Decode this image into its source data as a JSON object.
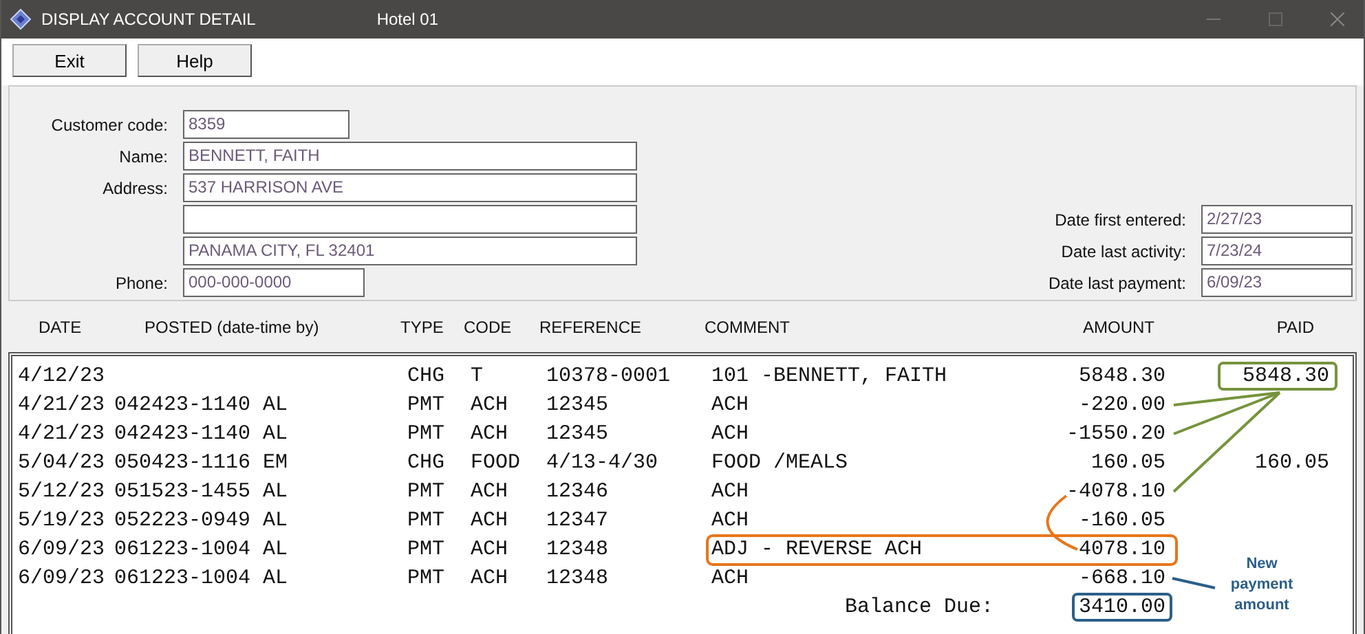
{
  "window": {
    "title": "DISPLAY ACCOUNT DETAIL",
    "subtitle": "Hotel 01"
  },
  "toolbar": {
    "buttons": [
      "Exit",
      "Help"
    ]
  },
  "customer": {
    "fields": [
      {
        "label": "Customer code:",
        "value": "8359",
        "kind": "short"
      },
      {
        "label": "Name:",
        "value": "BENNETT, FAITH",
        "kind": "long"
      },
      {
        "label": "Address:",
        "value": "537 HARRISON AVE",
        "kind": "long"
      },
      {
        "kind": "long"
      },
      {
        "value": "PANAMA CITY, FL 32401",
        "kind": "long"
      },
      {
        "label": "Phone:",
        "value": "000-000-0000",
        "kind": "medium"
      }
    ],
    "dates": [
      {
        "label": "Date first entered:",
        "value": "2/27/23"
      },
      {
        "label": "Date last activity:",
        "value": "7/23/24"
      },
      {
        "label": "Date last payment:",
        "value": "6/09/23"
      }
    ]
  },
  "ledger": {
    "columns": [
      "DATE",
      "POSTED (date-time by)",
      "TYPE",
      "CODE",
      "REFERENCE",
      "COMMENT",
      "AMOUNT",
      "PAID"
    ],
    "rows": [
      {
        "date": "4/12/23",
        "type": "CHG",
        "code": "T",
        "reference": "10378-0001",
        "comment": "101 -BENNETT, FAITH",
        "amount": "5848.30",
        "paid": "5848.30",
        "kind": "boxed-paid"
      },
      {
        "date": "4/21/23",
        "posted": "042423-1140 AL",
        "type": "PMT",
        "code": "ACH",
        "reference": "12345",
        "comment": "ACH",
        "amount": "-220.00",
        "kind": "linked"
      },
      {
        "date": "4/21/23",
        "posted": "042423-1140 AL",
        "type": "PMT",
        "code": "ACH",
        "reference": "12345",
        "comment": "ACH",
        "amount": "-1550.20",
        "kind": "linked"
      },
      {
        "date": "5/04/23",
        "posted": "050423-1116 EM",
        "type": "CHG",
        "code": "FOOD",
        "reference": "4/13-4/30",
        "comment": "FOOD /MEALS",
        "amount": "160.05",
        "paid": "160.05",
        "kind": "plain"
      },
      {
        "date": "5/12/23",
        "posted": "051523-1455 AL",
        "type": "PMT",
        "code": "ACH",
        "reference": "12346",
        "comment": "ACH",
        "amount": "-4078.10",
        "kind": "linked-reversed"
      },
      {
        "date": "5/19/23",
        "posted": "052223-0949 AL",
        "type": "PMT",
        "code": "ACH",
        "reference": "12347",
        "comment": "ACH",
        "amount": "-160.05",
        "kind": "plain"
      },
      {
        "date": "6/09/23",
        "posted": "061223-1004 AL",
        "type": "PMT",
        "code": "ACH",
        "reference": "12348",
        "comment": "ADJ - REVERSE ACH",
        "amount": "4078.10",
        "kind": "boxed"
      },
      {
        "date": "6/09/23",
        "posted": "061223-1004 AL",
        "type": "PMT",
        "code": "ACH",
        "reference": "12348",
        "comment": "ACH",
        "amount": "-668.10",
        "kind": "noted"
      }
    ],
    "balance": {
      "label": "Balance Due:",
      "value": "3410.00"
    },
    "note": "New payment amount"
  }
}
